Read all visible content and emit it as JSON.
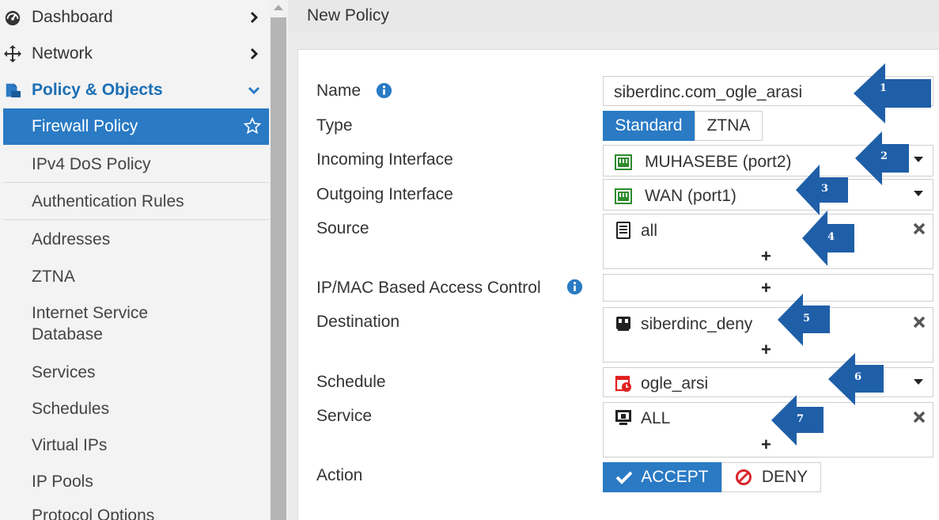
{
  "sidebar": {
    "top_items": [
      {
        "label": "Dashboard",
        "icon": "dashboard-gauge-icon"
      },
      {
        "label": "Network",
        "icon": "network-arrows-icon"
      }
    ],
    "section": {
      "label": "Policy & Objects",
      "icon": "policy-objects-icon",
      "expanded": true
    },
    "items": [
      {
        "label": "Firewall Policy",
        "active": true
      },
      {
        "label": "IPv4 DoS Policy"
      },
      {
        "label": "Authentication Rules"
      },
      {
        "label": "Addresses"
      },
      {
        "label": "ZTNA"
      },
      {
        "label": "Internet Service Database"
      },
      {
        "label": "Services"
      },
      {
        "label": "Schedules"
      },
      {
        "label": "Virtual IPs"
      },
      {
        "label": "IP Pools"
      },
      {
        "label": "Protocol Options"
      }
    ]
  },
  "page": {
    "title": "New Policy"
  },
  "form": {
    "name": {
      "label": "Name",
      "value": "siberdinc.com_ogle_arasi"
    },
    "type": {
      "label": "Type",
      "options": [
        "Standard",
        "ZTNA"
      ],
      "selected": "Standard"
    },
    "incoming": {
      "label": "Incoming Interface",
      "value": "MUHASEBE (port2)",
      "icon": "interface-port-icon"
    },
    "outgoing": {
      "label": "Outgoing Interface",
      "value": "WAN (port1)",
      "icon": "interface-port-icon"
    },
    "source": {
      "label": "Source",
      "value": "all",
      "icon": "address-list-icon"
    },
    "ipmac": {
      "label": "IP/MAC Based Access Control"
    },
    "destination": {
      "label": "Destination",
      "value": "siberdinc_deny",
      "icon": "address-object-icon"
    },
    "schedule": {
      "label": "Schedule",
      "value": "ogle_arsi",
      "icon": "schedule-clock-icon"
    },
    "service": {
      "label": "Service",
      "value": "ALL",
      "icon": "service-monitor-icon"
    },
    "action": {
      "label": "Action",
      "options": [
        "ACCEPT",
        "DENY"
      ],
      "selected": "ACCEPT"
    },
    "add_symbol": "+"
  },
  "callouts": [
    "1",
    "2",
    "3",
    "4",
    "5",
    "6",
    "7"
  ],
  "colors": {
    "accent": "#2a7ac4",
    "callout_blue": "#1f5fa8",
    "interface_green": "#2e8b2e",
    "schedule_red": "#e02020",
    "deny_red": "#d9262c"
  }
}
